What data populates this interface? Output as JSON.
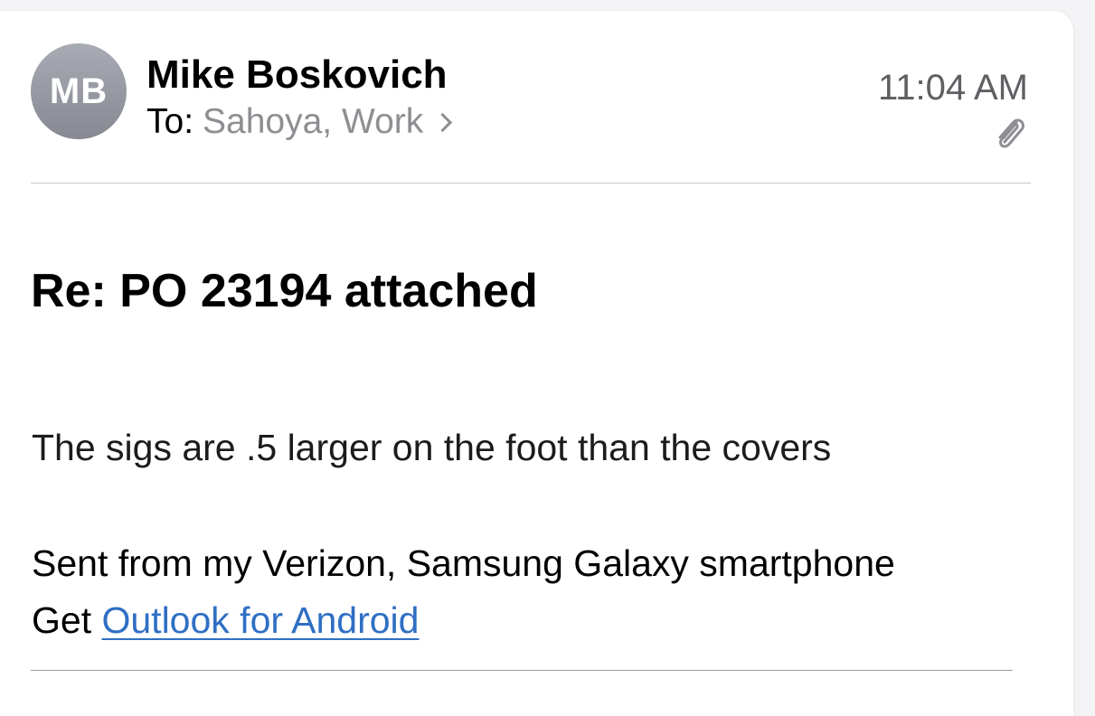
{
  "message": {
    "sender_initials": "MB",
    "sender_name": "Mike Boskovich",
    "to_label": "To:",
    "recipients": "Sahoya, Work",
    "time": "11:04 AM",
    "attachment_icon": "paperclip-icon",
    "subject": "Re: PO 23194 attached",
    "body": {
      "line1": "The sigs are .5 larger on the foot than the covers",
      "line2": "Sent from my Verizon, Samsung Galaxy smartphone",
      "line3_prefix": "Get ",
      "line3_link": "Outlook for Android"
    }
  },
  "colors": {
    "link": "#2f6fc4",
    "secondary_text": "#8e8e93",
    "avatar": "#8e9199"
  }
}
